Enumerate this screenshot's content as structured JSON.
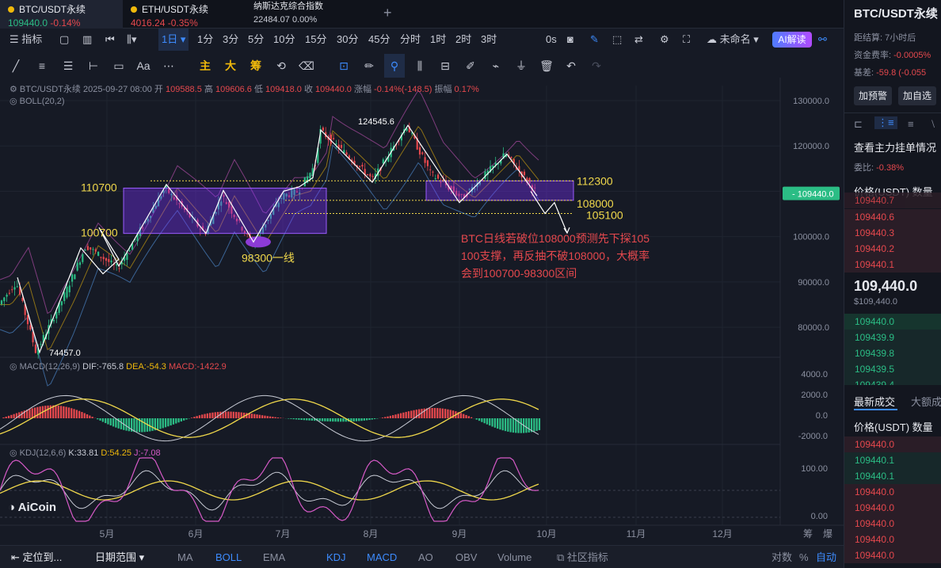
{
  "tabs": [
    {
      "title": "BTC/USDT永续",
      "price": "109440.0",
      "change": "-0.14%"
    },
    {
      "title": "ETH/USDT永续",
      "price": "4016.24",
      "change": "-0.35%"
    },
    {
      "title": "纳斯达克综合指数",
      "price": "22484.07",
      "change": "0.00%"
    }
  ],
  "toolbar": {
    "indicator": "指标",
    "active_period": "1日",
    "periods": [
      "1分",
      "3分",
      "5分",
      "10分",
      "15分",
      "30分",
      "45分",
      "分时",
      "1时",
      "2时",
      "3时"
    ],
    "countdown": "0s",
    "layout_name": "未命名",
    "ai_label": "AI解读"
  },
  "draw_tools": [
    "主",
    "大",
    "筹"
  ],
  "ohlc": {
    "symbol": "BTC/USDT永续",
    "date": "2025-09-27 08:00",
    "open_label": "开",
    "open": "109588.5",
    "high_label": "高",
    "high": "109606.6",
    "low_label": "低",
    "low": "109418.0",
    "close_label": "收",
    "close": "109440.0",
    "chg_label": "涨幅",
    "chg": "-0.14%(-148.5)",
    "amp_label": "振幅",
    "amp": "0.17%"
  },
  "boll_label": "BOLL(20,2)",
  "macd": {
    "label": "MACD(12,26,9)",
    "dif": "DIF:-765.8",
    "dea": "DEA:-54.3",
    "macd": "MACD:-1422.9"
  },
  "kdj": {
    "label": "KDJ(12,6,6)",
    "k": "K:33.81",
    "d": "D:54.25",
    "j": "J:-7.08"
  },
  "logo": "AiCoin",
  "price_axis": [
    "130000.0",
    "120000.0",
    "110000.0",
    "100000.0",
    "90000.0",
    "80000.0"
  ],
  "current_price_tag": "109440.0",
  "macd_axis": [
    "4000.0",
    "2000.0",
    "0.0",
    "-2000.0"
  ],
  "kdj_axis": [
    "100.00",
    "0.00"
  ],
  "time_axis": [
    "5月",
    "6月",
    "7月",
    "8月",
    "9月",
    "10月",
    "11月",
    "12月"
  ],
  "time_axis_right": [
    "筹",
    "爆"
  ],
  "annotations": {
    "low_price": "74457.0",
    "high_price": "124545.6",
    "l110700": "110700",
    "l100700": "100700",
    "l98300": "98300一线",
    "l112300": "112300",
    "l108000": "108000",
    "l105100": "105100",
    "note": [
      "BTC日线若破位108000预测先下探105",
      "100支撑，再反抽不破108000，大概率",
      "会到100700-98300区间"
    ]
  },
  "bottom": {
    "locate": "定位到...",
    "range": "日期范围",
    "ma": "MA",
    "boll": "BOLL",
    "ema": "EMA",
    "kdj": "KDJ",
    "macd": "MACD",
    "ao": "AO",
    "obv": "OBV",
    "volume": "Volume",
    "community": "社区指标",
    "log": "对数",
    "pct": "%",
    "auto": "自动"
  },
  "side": {
    "title": "BTC/USDT永续",
    "settle_label": "距结算:",
    "settle": "7小时后",
    "fund_label": "资金费率:",
    "fund": "-0.0005%",
    "basis_label": "基差:",
    "basis": "-59.8 (-0.055",
    "alert": "加预警",
    "watch": "加自选",
    "depth_title": "查看主力挂单情况",
    "ratio_label": "委比:",
    "ratio": "-0.38%",
    "col_price": "价格(USDT)",
    "col_qty": "数量",
    "asks": [
      "109440.7",
      "109440.6",
      "109440.3",
      "109440.2",
      "109440.1"
    ],
    "last": "109,440.0",
    "last_usd": "$109,440.0",
    "bids": [
      "109440.0",
      "109439.9",
      "109439.8",
      "109439.5",
      "109439.4"
    ],
    "trade_tab": "最新成交",
    "big_tab": "大额成",
    "trades": [
      "109440.0",
      "109440.1",
      "109440.1",
      "109440.0",
      "109440.0",
      "109440.0",
      "109440.0",
      "109440.0"
    ]
  }
}
